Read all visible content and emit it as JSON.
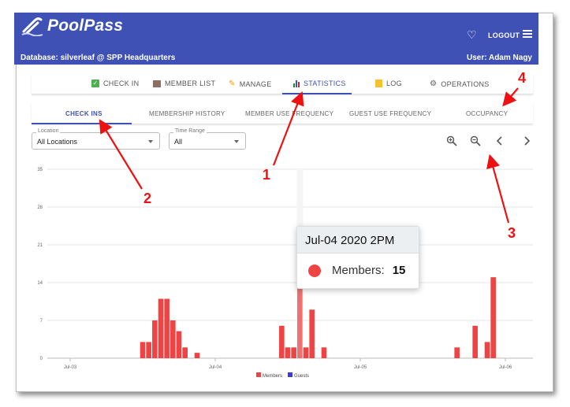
{
  "app": {
    "name": "PoolPass",
    "database": "Database: silverleaf @ SPP Headquarters",
    "user": "User: Adam Nagy",
    "logout": "LOGOUT"
  },
  "nav": {
    "items": [
      {
        "label": "CHECK IN",
        "icon": "check-box-icon",
        "color": "#4caf50"
      },
      {
        "label": "MEMBER LIST",
        "icon": "list-icon",
        "color": "#8d6e63"
      },
      {
        "label": "MANAGE",
        "icon": "pencil-icon",
        "color": "#ff9800"
      },
      {
        "label": "STATISTICS",
        "icon": "bar-chart-icon",
        "color": "#3f51b5"
      },
      {
        "label": "LOG",
        "icon": "notepad-icon",
        "color": "#fbc02d"
      },
      {
        "label": "OPERATIONS",
        "icon": "gear-icon",
        "color": "#616161"
      }
    ],
    "active": "STATISTICS"
  },
  "subtabs": {
    "items": [
      "CHECK INS",
      "MEMBERSHIP HISTORY",
      "MEMBER USE FREQUENCY",
      "GUEST USE FREQUENCY",
      "OCCUPANCY"
    ],
    "active": "CHECK INS"
  },
  "filters": {
    "location": {
      "label": "Location",
      "value": "All Locations"
    },
    "time_range": {
      "label": "Time Range",
      "value": "All"
    }
  },
  "tooltip": {
    "title": "Jul-04 2020 2PM",
    "series": "Members:",
    "value": "15"
  },
  "callouts": [
    "1",
    "2",
    "3",
    "4"
  ],
  "colors": {
    "primary": "#3f51b5",
    "members": "#ef4444",
    "guests": "#3b3bdb",
    "callout": "#ee1111"
  },
  "chart_data": {
    "type": "bar",
    "title": "",
    "xlabel": "",
    "ylabel": "",
    "ylim": [
      0,
      35
    ],
    "y_ticks": [
      0,
      7,
      14,
      21,
      28,
      35
    ],
    "x_ticks": [
      "Jul-03",
      "Jul-04",
      "Jul-05",
      "Jul-06"
    ],
    "legend": [
      "Members",
      "Guests"
    ],
    "legend_position": "bottom",
    "grid": true,
    "series": [
      {
        "name": "Members",
        "color": "#ef4444",
        "points": [
          {
            "x": "Jul-03 12PM",
            "y": 3
          },
          {
            "x": "Jul-03 1PM",
            "y": 3
          },
          {
            "x": "Jul-03 2PM",
            "y": 7
          },
          {
            "x": "Jul-03 3PM",
            "y": 11
          },
          {
            "x": "Jul-03 4PM",
            "y": 11
          },
          {
            "x": "Jul-03 5PM",
            "y": 7
          },
          {
            "x": "Jul-03 6PM",
            "y": 5
          },
          {
            "x": "Jul-03 7PM",
            "y": 2
          },
          {
            "x": "Jul-03 9PM",
            "y": 1
          },
          {
            "x": "Jul-04 11AM",
            "y": 6
          },
          {
            "x": "Jul-04 12PM",
            "y": 2
          },
          {
            "x": "Jul-04 1PM",
            "y": 2
          },
          {
            "x": "Jul-04 2PM",
            "y": 15
          },
          {
            "x": "Jul-04 3PM",
            "y": 2
          },
          {
            "x": "Jul-04 4PM",
            "y": 9
          },
          {
            "x": "Jul-04 6PM",
            "y": 2
          },
          {
            "x": "Jul-05 4PM",
            "y": 2
          },
          {
            "x": "Jul-05 7PM",
            "y": 6
          },
          {
            "x": "Jul-05 9PM",
            "y": 3
          },
          {
            "x": "Jul-05 10PM",
            "y": 15
          }
        ]
      },
      {
        "name": "Guests",
        "color": "#3b3bdb",
        "points": []
      }
    ]
  }
}
